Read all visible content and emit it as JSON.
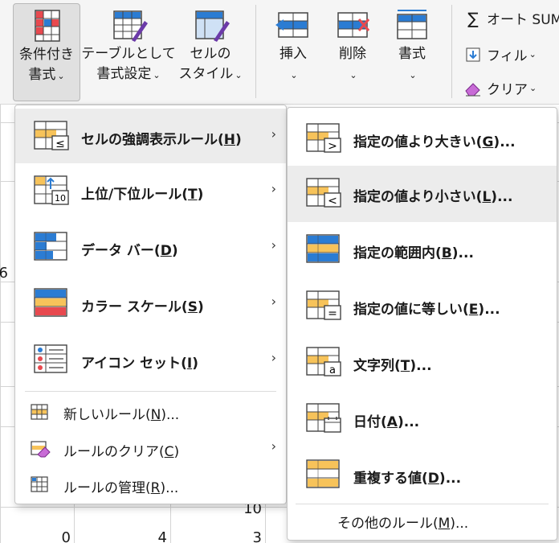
{
  "ribbon": {
    "conditional_format": {
      "line1": "条件付き",
      "line2": "書式"
    },
    "table_format": {
      "line1": "テーブルとして",
      "line2": "書式設定"
    },
    "cell_style": {
      "line1": "セルの",
      "line2": "スタイル"
    },
    "insert": {
      "label": "挿入"
    },
    "delete": {
      "label": "削除"
    },
    "format": {
      "label": "書式"
    },
    "autosum": {
      "label": "オート SUM"
    },
    "fill": {
      "label": "フィル"
    },
    "clear": {
      "label": "クリア"
    }
  },
  "sheet": {
    "values": [
      "6",
      "10",
      "0",
      "4",
      "3"
    ]
  },
  "menu1": {
    "items": [
      {
        "label": "セルの強調表示ルール",
        "key": "H"
      },
      {
        "label": "上位/下位ルール",
        "key": "T"
      },
      {
        "label": "データ バー",
        "key": "D"
      },
      {
        "label": "カラー スケール",
        "key": "S"
      },
      {
        "label": "アイコン セット",
        "key": "I"
      },
      {
        "label": "新しいルール",
        "key": "N",
        "suffix": "..."
      },
      {
        "label": "ルールのクリア",
        "key": "C"
      },
      {
        "label": "ルールの管理",
        "key": "R",
        "suffix": "..."
      }
    ],
    "icon_texts": {
      "top_bottom": "10"
    }
  },
  "menu2": {
    "items": [
      {
        "label": "指定の値より大きい",
        "key": "G",
        "suffix": "..."
      },
      {
        "label": "指定の値より小さい",
        "key": "L",
        "suffix": "..."
      },
      {
        "label": "指定の範囲内",
        "key": "B",
        "suffix": "..."
      },
      {
        "label": "指定の値に等しい",
        "key": "E",
        "suffix": "..."
      },
      {
        "label": "文字列",
        "key": "T",
        "suffix": "..."
      },
      {
        "label": "日付",
        "key": "A",
        "suffix": "..."
      },
      {
        "label": "重複する値",
        "key": "D",
        "suffix": "..."
      },
      {
        "label": "その他のルール",
        "key": "M",
        "suffix": "..."
      }
    ],
    "icon_texts": {
      "text_contains": "a"
    }
  },
  "colors": {
    "accent_blue": "#2b7cd3",
    "highlight_orange": "#f7c35a",
    "red": "#e8494f"
  }
}
